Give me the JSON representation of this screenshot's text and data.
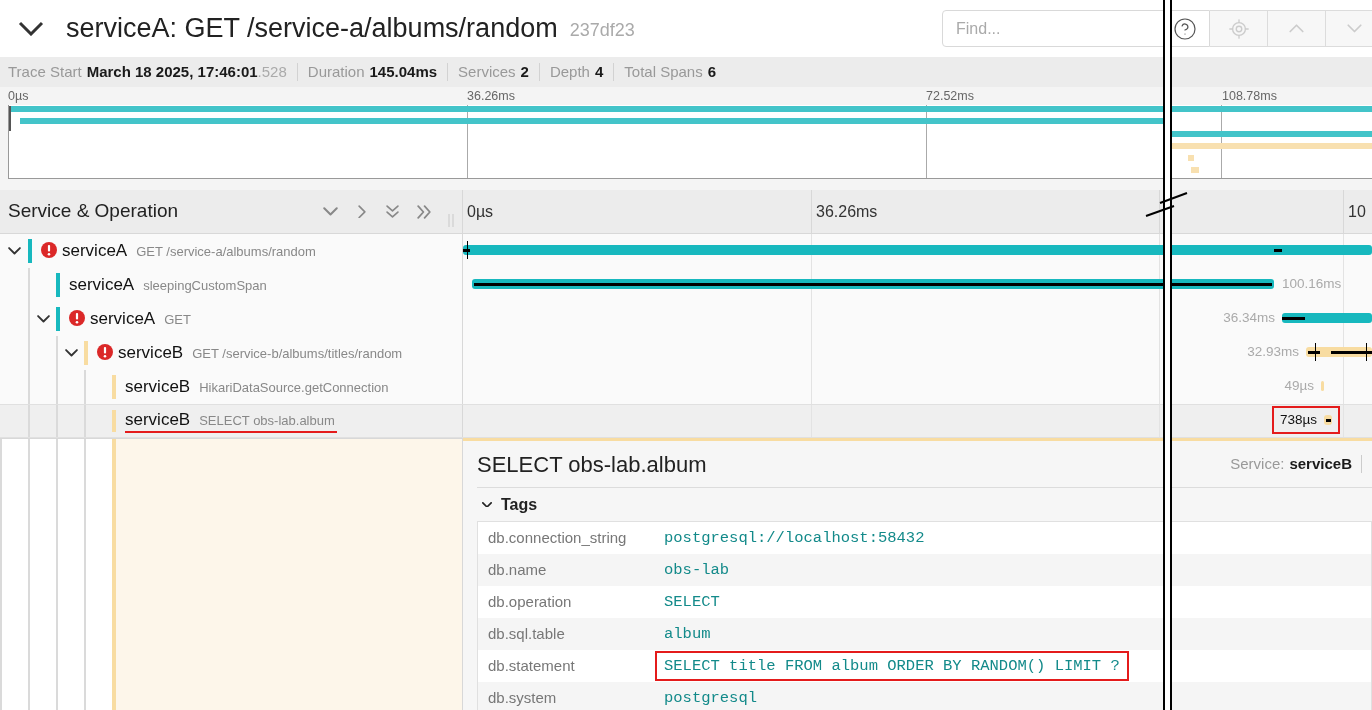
{
  "header": {
    "title": "serviceA: GET /service-a/albums/random",
    "trace_id": "237df23"
  },
  "search": {
    "placeholder": "Find..."
  },
  "toolbar_buttons": [
    {
      "kind": "locate",
      "disabled": true
    },
    {
      "kind": "previous",
      "disabled": true
    },
    {
      "kind": "next",
      "disabled": true
    }
  ],
  "trace_info": [
    {
      "label": "Trace Start",
      "value": "March 18 2025, 17:46:01",
      "value_suffix": ".528"
    },
    {
      "label": "Duration",
      "value": "145.04ms"
    },
    {
      "label": "Services",
      "value": "2"
    },
    {
      "label": "Depth",
      "value": "4"
    },
    {
      "label": "Total Spans",
      "value": "6"
    }
  ],
  "minimap": {
    "ticks": [
      "0µs",
      "36.26ms",
      "72.52ms",
      "108.78ms"
    ]
  },
  "timeline": {
    "title": "Service & Operation",
    "ticks": [
      "0µs",
      "36.26ms",
      "10"
    ]
  },
  "spans": [
    {
      "service": "serviceA",
      "operation": "GET /service-a/albums/random",
      "color": "#17b8be",
      "error": true,
      "expanded": true,
      "selected": false,
      "annotated": false,
      "children": [
        {
          "service": "serviceA",
          "operation": "sleepingCustomSpan",
          "color": "#17b8be",
          "error": false,
          "selected": false,
          "annotated": false,
          "duration": "100.16ms"
        },
        {
          "service": "serviceA",
          "operation": "GET",
          "color": "#17b8be",
          "error": true,
          "expanded": true,
          "selected": false,
          "annotated": false,
          "duration": "36.34ms",
          "children": [
            {
              "service": "serviceB",
              "operation": "GET /service-b/albums/titles/random",
              "color": "#f8dca1",
              "error": true,
              "expanded": true,
              "selected": false,
              "annotated": false,
              "duration": "32.93ms",
              "children": [
                {
                  "service": "serviceB",
                  "operation": "HikariDataSource.getConnection",
                  "color": "#f8dca1",
                  "error": false,
                  "selected": false,
                  "annotated": false,
                  "duration": "49µs"
                },
                {
                  "service": "serviceB",
                  "operation": "SELECT obs-lab.album",
                  "color": "#f8dca1",
                  "error": false,
                  "selected": true,
                  "annotated": true,
                  "duration": "738µs"
                }
              ]
            }
          ]
        }
      ]
    }
  ],
  "detail": {
    "title": "SELECT obs-lab.album",
    "service_label": "Service:",
    "service": "serviceB",
    "tags": {
      "title": "Tags",
      "expanded": true,
      "rows": [
        {
          "key": "db.connection_string",
          "value": "postgresql://localhost:58432",
          "annotated": false
        },
        {
          "key": "db.name",
          "value": "obs-lab",
          "annotated": false
        },
        {
          "key": "db.operation",
          "value": "SELECT",
          "annotated": false
        },
        {
          "key": "db.sql.table",
          "value": "album",
          "annotated": false
        },
        {
          "key": "db.statement",
          "value": "SELECT title FROM album ORDER BY RANDOM() LIMIT ?",
          "annotated": true
        },
        {
          "key": "db.system",
          "value": "postgresql",
          "annotated": false
        }
      ]
    }
  }
}
